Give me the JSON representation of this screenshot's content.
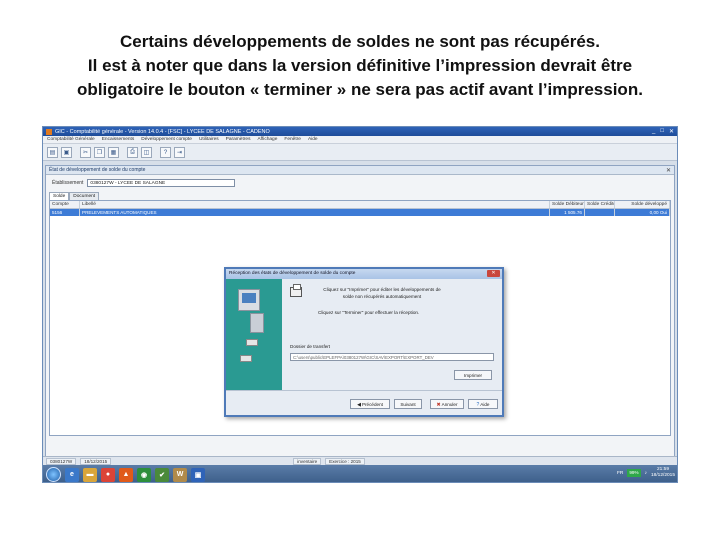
{
  "caption": {
    "line1": "Certains développements de soldes ne sont pas récupérés.",
    "line2": "Il est à noter que dans la version définitive l’impression devrait être",
    "line3": "obligatoire le bouton « terminer » ne sera pas actif avant l’impression."
  },
  "app": {
    "title": "GIC - Comptabilité générale - Version 14.0.4 - [FSC] - LYCEE DE SALAGNE - CADENO",
    "menu": [
      "Comptabilité Générale",
      "Encaissements",
      "Développement compte",
      "Utilitaires",
      "Paramètres",
      "Affichage",
      "Fenêtre",
      "Aide"
    ]
  },
  "inner_window": {
    "title": "État de développement de solde du compte",
    "estab_label": "Établissement",
    "estab_value": "0380127W - LYCEE DE SALAGNE",
    "tabs": [
      "Solde",
      "Document"
    ],
    "columns": [
      "Compte",
      "Libellé",
      "Solde Débiteur",
      "Solde Créditeur",
      "Solde développé"
    ],
    "rows": [
      {
        "compte": "5156",
        "libelle": "PRELEVEMENTS AUTOMATIQUES",
        "debiteur": "1 505.76",
        "crediteur": "",
        "developpe": "0,00 Oui"
      }
    ]
  },
  "dialog": {
    "title": "Réception des états de développement de solde du compte",
    "text1": "Cliquez sur \"Imprimer\" pour éditer les développements de solde non récupérés automatiquement",
    "text2": "Cliquez sur \"Terminer\" pour effectuer la réception.",
    "dest_label": "Dossier de transfert",
    "dest_path": "C:\\users\\public\\EPLEFPA\\0380127W\\GIC\\SAV\\EXPORT\\EXPORT_DEV",
    "print_button": "Imprimer",
    "buttons": {
      "prev": "Précédent",
      "next": "Suivant",
      "cancel": "Annuler",
      "help": "Aide"
    }
  },
  "statusbar": {
    "code": "0380127W",
    "date": "18/12/2015",
    "user": "inventaire",
    "exercise": "Exercice : 2015"
  },
  "taskbar": {
    "lang": "FR",
    "battery": "99%",
    "time": "21:59",
    "date": "18/12/2015"
  }
}
